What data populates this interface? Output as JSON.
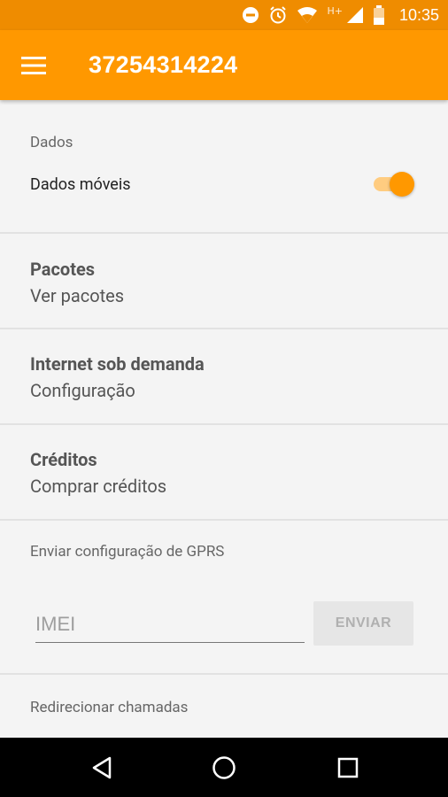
{
  "status_bar": {
    "time": "10:35",
    "network_type": "H+",
    "icons": [
      "do-not-disturb-icon",
      "alarm-icon",
      "wifi-icon",
      "signal-icon",
      "battery-icon"
    ]
  },
  "app_bar": {
    "title": "37254314224",
    "menu_icon": "hamburger-menu-icon"
  },
  "sections": {
    "dados": {
      "header": "Dados",
      "mobile_data_label": "Dados móveis",
      "mobile_data_enabled": true
    },
    "pacotes": {
      "title": "Pacotes",
      "subtitle": "Ver pacotes"
    },
    "internet": {
      "title": "Internet sob demanda",
      "subtitle": "Configuração"
    },
    "creditos": {
      "title": "Créditos",
      "subtitle": "Comprar créditos"
    },
    "gprs": {
      "header": "Enviar configuração de GPRS",
      "imei_placeholder": "IMEI",
      "imei_value": "",
      "send_label": "ENVIAR"
    },
    "redirect": {
      "header": "Redirecionar chamadas"
    }
  },
  "nav_bar": {
    "icons": [
      "back-icon",
      "home-icon",
      "recents-icon"
    ]
  },
  "colors": {
    "primary": "#ff9800",
    "primary_dark": "#ef8c00",
    "background": "#f4f4f4"
  }
}
